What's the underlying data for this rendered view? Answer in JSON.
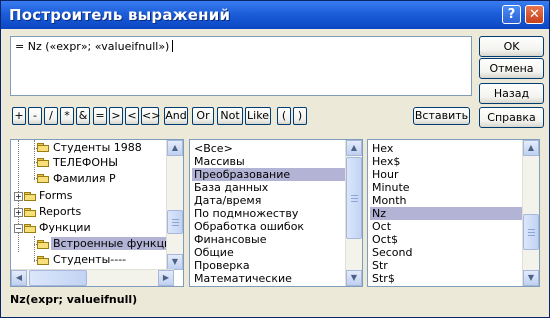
{
  "window": {
    "title": "Построитель выражений"
  },
  "titlebar": {
    "help": "?",
    "close": "✕"
  },
  "expression": {
    "value": "= Nz («expr»; «valueifnull»)"
  },
  "side_buttons": {
    "ok": "OK",
    "cancel": "Отмена",
    "back": "Назад",
    "help": "Справка"
  },
  "operators": [
    "+",
    "-",
    "/",
    "*",
    "&",
    "=",
    ">",
    "<",
    "<>",
    "And",
    "Or",
    "Not",
    "Like",
    "(",
    ")"
  ],
  "paste_button": "Вставить",
  "tree": {
    "items": [
      {
        "label": "Студенты 1988",
        "type": "folder"
      },
      {
        "label": "ТЕЛЕФОНЫ",
        "type": "folder"
      },
      {
        "label": "Фамилия Р",
        "type": "folder"
      },
      {
        "label": "Forms",
        "type": "expandable"
      },
      {
        "label": "Reports",
        "type": "expandable"
      },
      {
        "label": "Функции",
        "type": "expanded"
      },
      {
        "label": "Встроенные функции",
        "type": "folder-open",
        "selected": true
      },
      {
        "label": "Студенты----",
        "type": "folder"
      }
    ]
  },
  "categories": {
    "items": [
      "<Все>",
      "Массивы",
      "Преобразование",
      "База данных",
      "Дата/время",
      "По подмножеству",
      "Обработка ошибок",
      "Финансовые",
      "Общие",
      "Проверка",
      "Математические"
    ],
    "selected_index": 2
  },
  "functions": {
    "items": [
      "Hex",
      "Hex$",
      "Hour",
      "Minute",
      "Month",
      "Nz",
      "Oct",
      "Oct$",
      "Second",
      "Str",
      "Str$"
    ],
    "selected_index": 5
  },
  "status": {
    "syntax": "Nz(expr; valueifnull)"
  },
  "colors": {
    "titlebar": "#0b46c4",
    "selection": "#b3b3d6",
    "dialog_bg": "#ece9d8"
  }
}
